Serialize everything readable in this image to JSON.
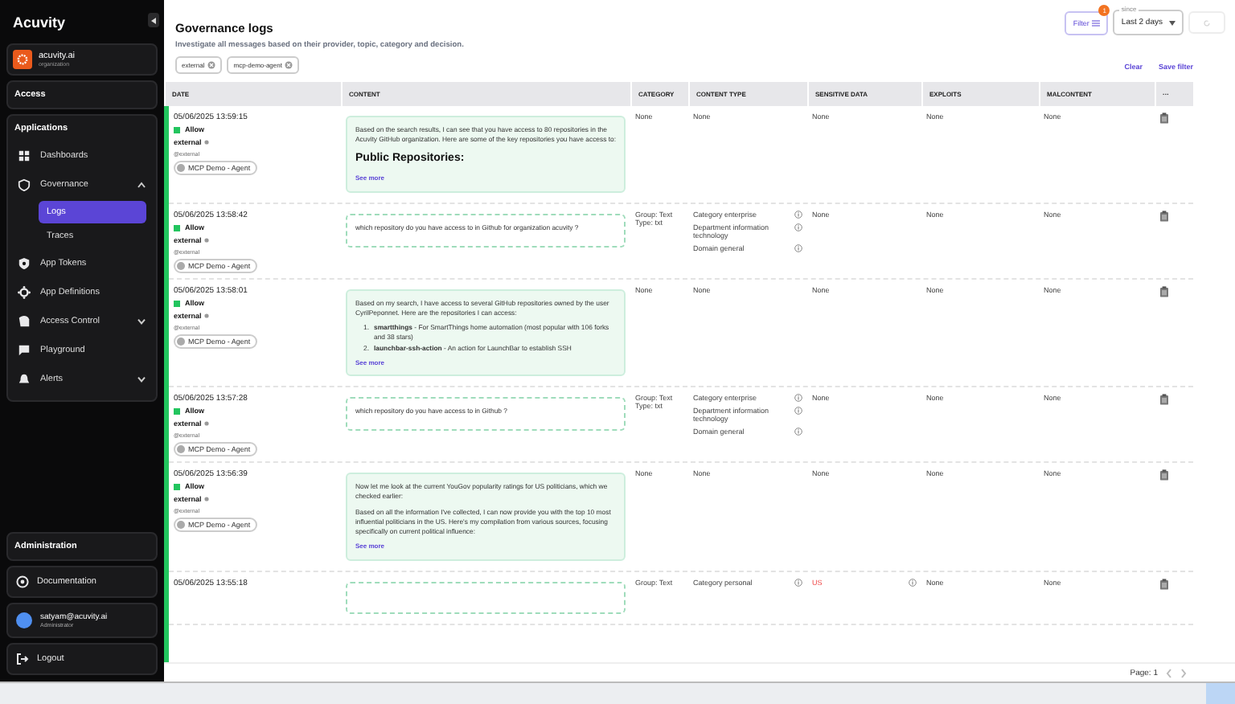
{
  "sidebar": {
    "logo": "Acuvity",
    "org": {
      "name": "acuvity.ai",
      "role": "organization"
    },
    "access": {
      "title": "Access"
    },
    "applications": {
      "title": "Applications",
      "items": [
        {
          "label": "Dashboards",
          "selected": false
        },
        {
          "label": "Governance",
          "selected": false,
          "expanded": true,
          "children": [
            {
              "label": "Logs",
              "selected": true
            },
            {
              "label": "Traces",
              "selected": false
            }
          ]
        },
        {
          "label": "App Tokens",
          "selected": false
        },
        {
          "label": "App Definitions",
          "selected": false
        },
        {
          "label": "Access Control",
          "selected": false,
          "expanded": false
        },
        {
          "label": "Playground",
          "selected": false
        },
        {
          "label": "Alerts",
          "selected": false,
          "expanded": false
        }
      ]
    },
    "administration": {
      "title": "Administration"
    },
    "documentation": {
      "label": "Documentation"
    },
    "user": {
      "email": "satyam@acuvity.ai",
      "role": "Administrator"
    },
    "logout": {
      "label": "Logout"
    }
  },
  "header": {
    "title": "Governance logs",
    "subtitle": "Investigate all messages based on their provider, topic, category and decision.",
    "filter": {
      "label": "Filter",
      "badge": "1"
    },
    "since": {
      "label": "since",
      "value": "Last 2 days"
    },
    "refresh": {
      "disabled": true
    },
    "chips": [
      "external",
      "mcp-demo-agent"
    ],
    "actions": [
      "Clear",
      "Save filter"
    ]
  },
  "table": {
    "columns": [
      "DATE",
      "CONTENT",
      "CATEGORY",
      "CONTENT TYPE",
      "SENSITIVE DATA",
      "EXPLOITS",
      "MALCONTENT",
      "···"
    ],
    "rows": [
      {
        "date": "05/06/2025 13:59:15",
        "decision": {
          "label": "Allow",
          "color": "#22c55e"
        },
        "provider": "external",
        "tag": "@external",
        "agent": "MCP Demo - Agent",
        "content": {
          "kind": "response",
          "blocks": [
            {
              "kind": "paragraph",
              "text": "Based on the search results, I can see that you have access to 80 repositories in the Acuvity GitHub organization. Here are some of the key repositories you have access to:"
            },
            {
              "kind": "heading",
              "text": "Public Repositories:"
            }
          ],
          "see_more": "See more"
        },
        "category": [
          "None"
        ],
        "content_type": [
          {
            "label": "None",
            "info": false
          }
        ],
        "sensitive": [
          {
            "label": "None",
            "flagged": false
          }
        ],
        "exploits": "None",
        "malcontent": "None"
      },
      {
        "date": "05/06/2025 13:58:42",
        "decision": {
          "label": "Allow",
          "color": "#22c55e"
        },
        "provider": "external",
        "tag": "@external",
        "agent": "MCP Demo - Agent",
        "content": {
          "kind": "prompt",
          "blocks": [
            {
              "kind": "paragraph",
              "text": "which repository do you have access to in Github for organization acuvity ?"
            }
          ]
        },
        "category": [
          "Group: Text",
          "Type: txt"
        ],
        "content_type": [
          {
            "label": "Category enterprise",
            "info": true
          },
          {
            "label": "Department information technology",
            "info": true
          },
          {
            "label": "Domain general",
            "info": true
          }
        ],
        "sensitive": [
          {
            "label": "None",
            "flagged": false
          }
        ],
        "exploits": "None",
        "malcontent": "None"
      },
      {
        "date": "05/06/2025 13:58:01",
        "decision": {
          "label": "Allow",
          "color": "#22c55e"
        },
        "provider": "external",
        "tag": "@external",
        "agent": "MCP Demo - Agent",
        "content": {
          "kind": "response",
          "blocks": [
            {
              "kind": "paragraph",
              "text": "Based on my search, I have access to several GitHub repositories owned by the user CyrilPeponnet. Here are the repositories I can access:"
            },
            {
              "kind": "list_item",
              "marker": "1.",
              "text": "**smartthings** - For SmartThings home automation (most popular with 106 forks and 38 stars)"
            },
            {
              "kind": "list_item",
              "marker": "2.",
              "text": "**launchbar-ssh-action** - An action for LaunchBar to establish SSH"
            }
          ],
          "see_more": "See more"
        },
        "category": [
          "None"
        ],
        "content_type": [
          {
            "label": "None",
            "info": false
          }
        ],
        "sensitive": [
          {
            "label": "None",
            "flagged": false
          }
        ],
        "exploits": "None",
        "malcontent": "None"
      },
      {
        "date": "05/06/2025 13:57:28",
        "decision": {
          "label": "Allow",
          "color": "#22c55e"
        },
        "provider": "external",
        "tag": "@external",
        "agent": "MCP Demo - Agent",
        "content": {
          "kind": "prompt",
          "blocks": [
            {
              "kind": "paragraph",
              "text": "which repository do you have access to in Github ?"
            }
          ]
        },
        "category": [
          "Group: Text",
          "Type: txt"
        ],
        "content_type": [
          {
            "label": "Category enterprise",
            "info": true
          },
          {
            "label": "Department information technology",
            "info": true
          },
          {
            "label": "Domain general",
            "info": true
          }
        ],
        "sensitive": [
          {
            "label": "None",
            "flagged": false
          }
        ],
        "exploits": "None",
        "malcontent": "None"
      },
      {
        "date": "05/06/2025 13:56:39",
        "decision": {
          "label": "Allow",
          "color": "#22c55e"
        },
        "provider": "external",
        "tag": "@external",
        "agent": "MCP Demo - Agent",
        "content": {
          "kind": "response",
          "blocks": [
            {
              "kind": "paragraph",
              "text": "Now let me look at the current YouGov popularity ratings for US politicians, which we checked earlier:"
            },
            {
              "kind": "paragraph",
              "text": "Based on all the information I've collected, I can now provide you with the top 10 most influential politicians in the US. Here's my compilation from various sources, focusing specifically on current political influence:"
            }
          ],
          "see_more": "See more"
        },
        "category": [
          "None"
        ],
        "content_type": [
          {
            "label": "None",
            "info": false
          }
        ],
        "sensitive": [
          {
            "label": "None",
            "flagged": false
          }
        ],
        "exploits": "None",
        "malcontent": "None"
      },
      {
        "date": "05/06/2025 13:55:18",
        "content": {
          "kind": "prompt"
        },
        "category": [
          "Group: Text"
        ],
        "content_type": [
          {
            "label": "Category personal",
            "info": true
          }
        ],
        "sensitive": [
          {
            "label": "US",
            "flagged": true
          }
        ],
        "exploits": "None",
        "malcontent": "None"
      }
    ]
  },
  "footer": {
    "page": "Page: 1"
  }
}
